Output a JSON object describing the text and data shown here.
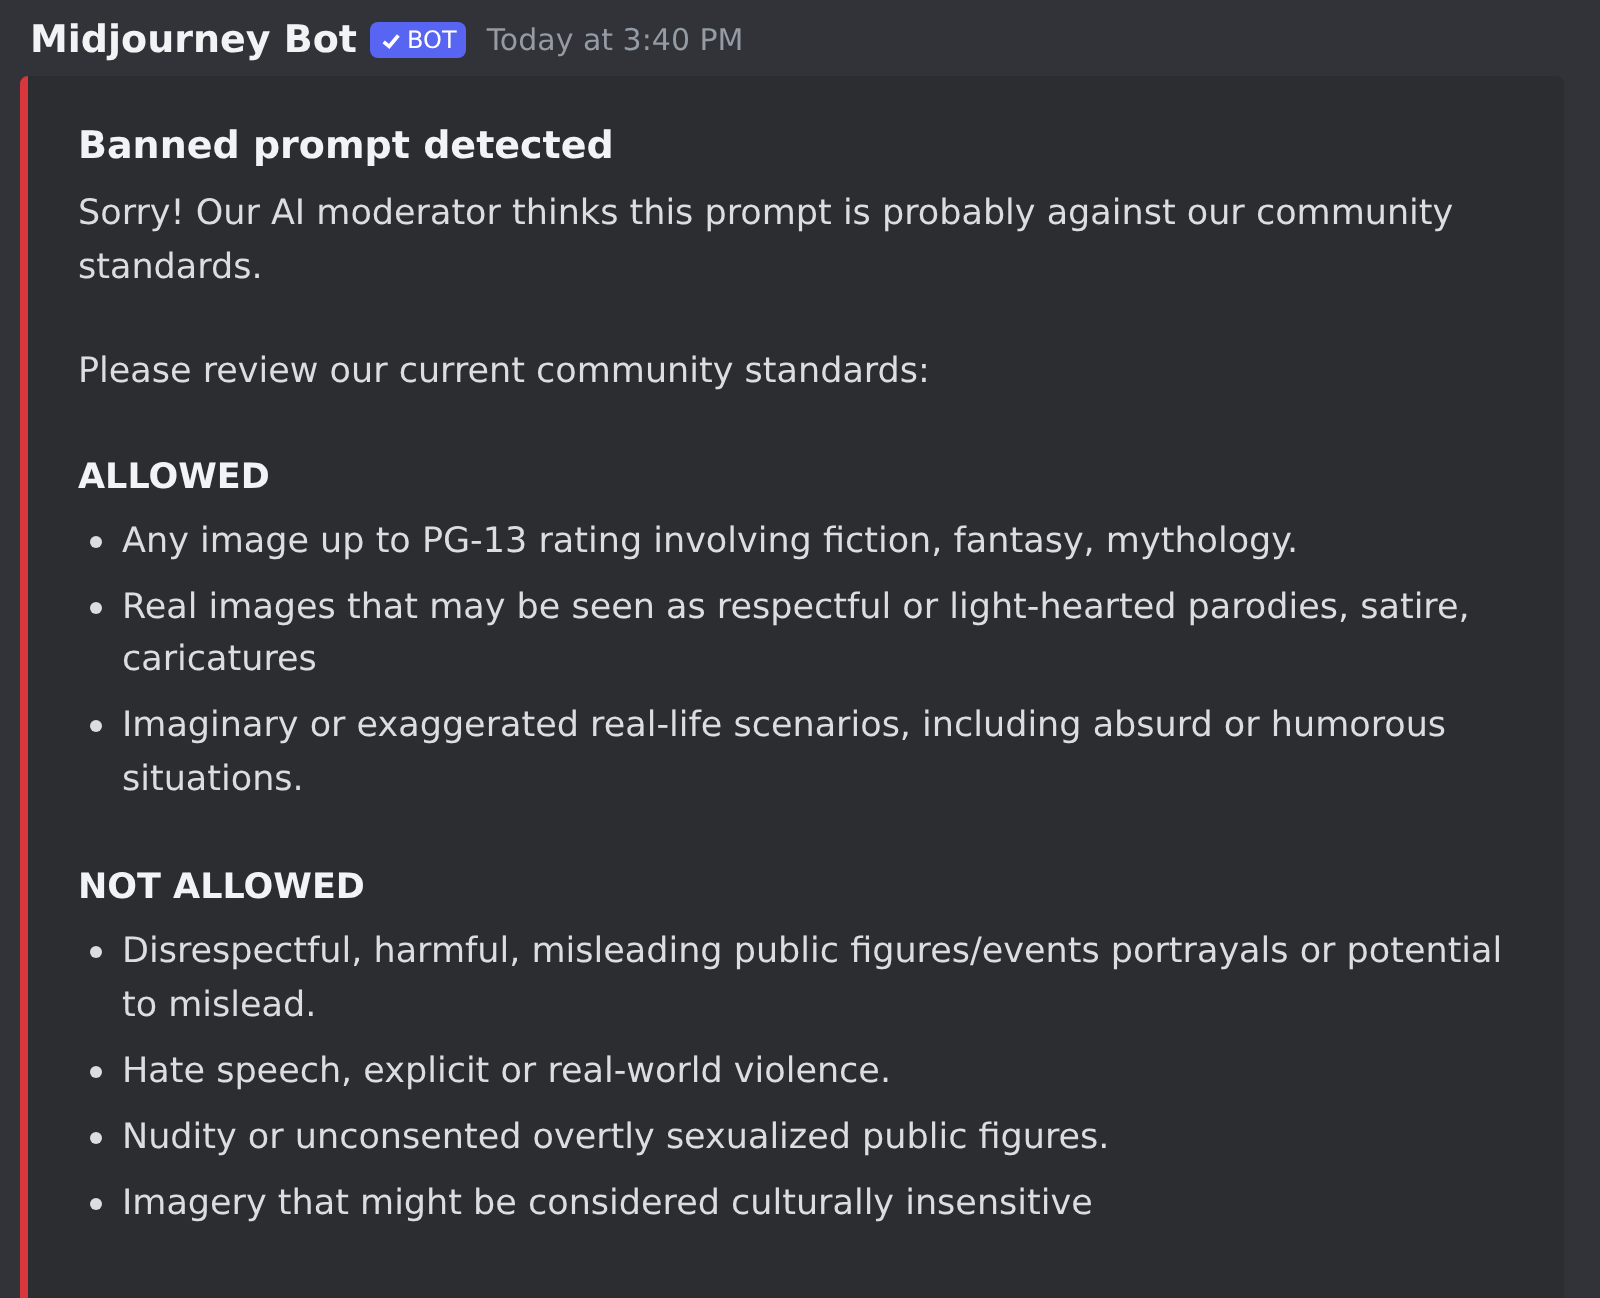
{
  "message": {
    "author": "Midjourney Bot",
    "badge": "BOT",
    "timestamp": "Today at 3:40 PM"
  },
  "embed": {
    "color": "#da373c",
    "title": "Banned prompt detected",
    "paragraphs": [
      "Sorry! Our AI moderator thinks this prompt is probably against our community standards.",
      "Please review our current community standards:"
    ],
    "sections": [
      {
        "heading": "ALLOWED",
        "items": [
          "Any image up to PG-13 rating involving fiction, fantasy, mythology.",
          "Real images that may be seen as respectful or light-hearted parodies, satire, caricatures",
          "Imaginary or exaggerated real-life scenarios, including absurd or humorous situations."
        ]
      },
      {
        "heading": "NOT ALLOWED",
        "items": [
          "Disrespectful, harmful, misleading public figures/events portrayals or potential to mislead.",
          "Hate speech, explicit or real-world violence.",
          "Nudity or unconsented overtly sexualized public figures.",
          "Imagery that might be considered culturally insensitive"
        ]
      }
    ]
  }
}
